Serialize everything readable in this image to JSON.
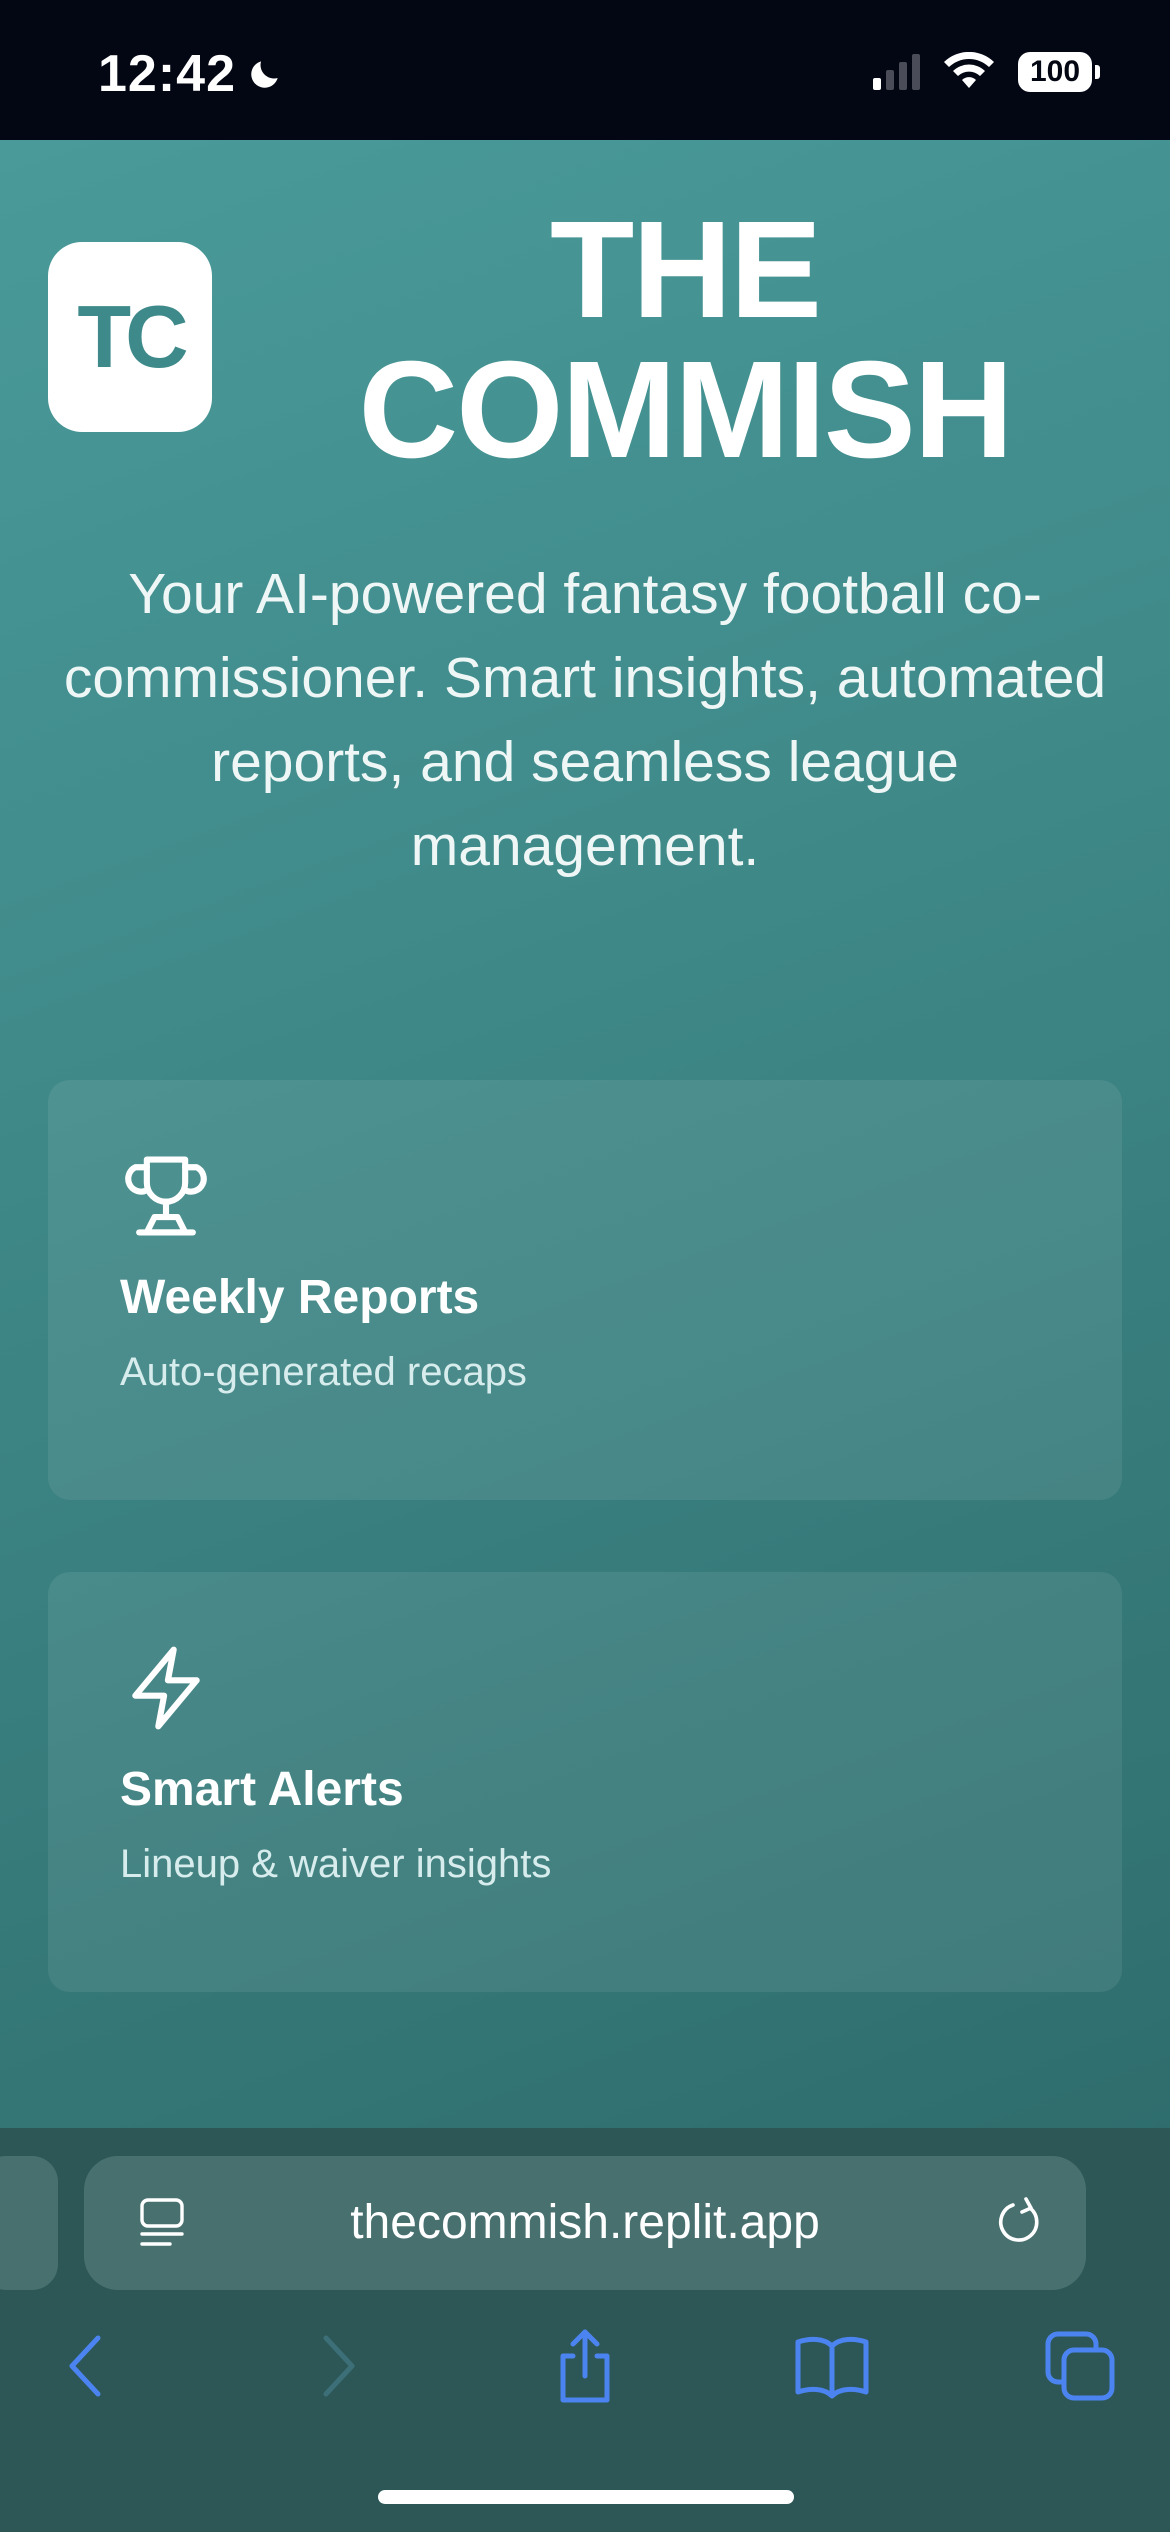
{
  "status_bar": {
    "time": "12:42",
    "battery": "100",
    "icons": [
      "moon-icon",
      "signal-icon",
      "wifi-icon",
      "battery-icon"
    ]
  },
  "logo": {
    "text": "TC"
  },
  "hero": {
    "title_line1": "THE",
    "title_line2": "COMMISH",
    "subtitle": "Your AI-powered fantasy football co-commissioner. Smart insights, automated reports, and seamless league management."
  },
  "features": [
    {
      "icon": "trophy-icon",
      "title": "Weekly Reports",
      "description": "Auto-generated recaps"
    },
    {
      "icon": "lightning-icon",
      "title": "Smart Alerts",
      "description": "Lineup & waiver insights"
    }
  ],
  "browser": {
    "url": "thecommish.replit.app",
    "toolbar_icons": [
      "back-icon",
      "forward-icon",
      "share-icon",
      "bookmarks-icon",
      "tabs-icon"
    ]
  },
  "colors": {
    "brand_teal": "#3e8a8a",
    "accent_blue": "#4b84f0"
  }
}
